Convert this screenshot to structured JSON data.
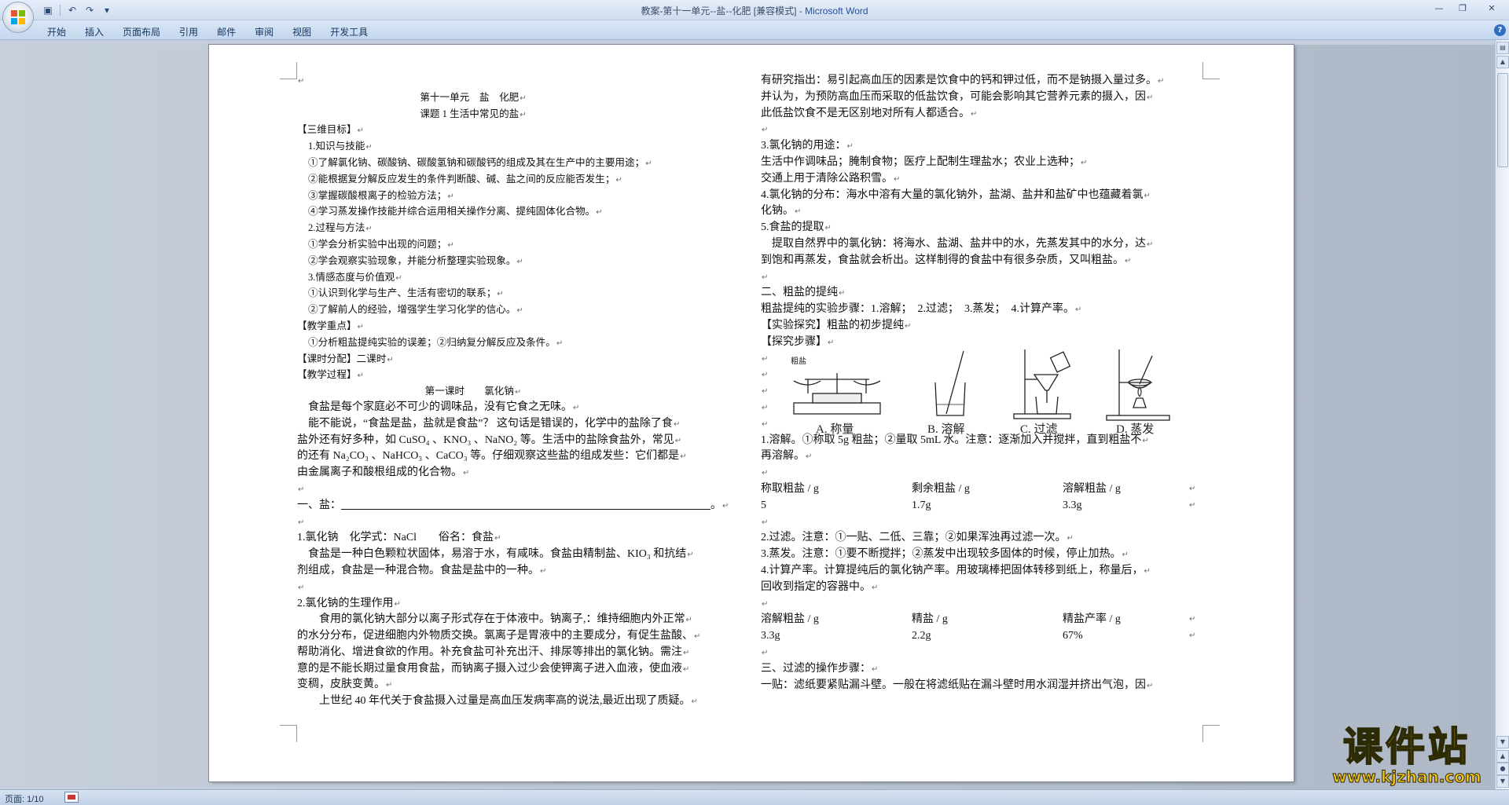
{
  "app": {
    "title_doc": "教案-第十一单元--盐--化肥 [兼容模式] - ",
    "title_app": "Microsoft Word"
  },
  "ribbon": {
    "tabs": [
      "开始",
      "插入",
      "页面布局",
      "引用",
      "邮件",
      "审阅",
      "视图",
      "开发工具"
    ]
  },
  "status": {
    "page": "页面: 1/10"
  },
  "watermark": {
    "title": "课件站",
    "url": "www.kjzhan.com"
  },
  "document": {
    "left": [
      {
        "t": "",
        "c": "ln"
      },
      {
        "t": "第十一单元　盐　化肥",
        "c": "ln center sm"
      },
      {
        "t": "课题 1  生活中常见的盐",
        "c": "ln center sm"
      },
      {
        "t": "【三维目标】",
        "c": "ln sm"
      },
      {
        "t": "1.知识与技能",
        "c": "ln sm i1"
      },
      {
        "t": "①了解氯化钠、碳酸钠、碳酸氢钠和碳酸钙的组成及其在生产中的主要用途；",
        "c": "ln sm i1"
      },
      {
        "t": "②能根据复分解反应发生的条件判断酸、碱、盐之间的反应能否发生；",
        "c": "ln sm i1"
      },
      {
        "t": "③掌握碳酸根离子的检验方法；",
        "c": "ln sm i1"
      },
      {
        "t": "④学习蒸发操作技能并综合运用相关操作分离、提纯固体化合物。",
        "c": "ln sm i1"
      },
      {
        "t": "2.过程与方法",
        "c": "ln sm i1"
      },
      {
        "t": "①学会分析实验中出现的问题；",
        "c": "ln sm i1"
      },
      {
        "t": "②学会观察实验现象，并能分析整理实验现象。",
        "c": "ln sm i1"
      },
      {
        "t": "3.情感态度与价值观",
        "c": "ln sm i1"
      },
      {
        "t": "①认识到化学与生产、生活有密切的联系；",
        "c": "ln sm i1"
      },
      {
        "t": "②了解前人的经验，增强学生学习化学的信心。",
        "c": "ln sm i1"
      },
      {
        "t": "【教学重点】",
        "c": "ln sm"
      },
      {
        "t": "①分析粗盐提纯实验的误差；②归纳复分解反应及条件。",
        "c": "ln sm i1"
      },
      {
        "t": "【课时分配】二课时",
        "c": "ln sm"
      },
      {
        "t": "【教学过程】",
        "c": "ln sm"
      },
      {
        "t": "第一课时　　氯化钠",
        "c": "ln center sm"
      },
      {
        "t": "食盐是每个家庭必不可少的调味品，没有它食之无味。",
        "c": "ln i1"
      },
      {
        "t": "能不能说，“食盐是盐，盐就是食盐”？ 这句话是错误的，化学中的盐除了食",
        "c": "ln i1"
      },
      {
        "t": "盐外还有好多种，如 CuSO₄ 、KNO₃ 、NaNO₂ 等。生活中的盐除食盐外，常见",
        "c": "ln"
      },
      {
        "t": "的还有 Na₂CO₃ 、NaHCO₃ 、CaCO₃ 等。仔细观察这些盐的组成发些：它们都是",
        "c": "ln"
      },
      {
        "t": "由金属离子和酸根组成的化合物。",
        "c": "ln"
      },
      {
        "t": "",
        "c": "ln"
      },
      {
        "t": "一、盐：",
        "c": "ln",
        "blank": true,
        "after": "。"
      },
      {
        "t": "",
        "c": "ln"
      },
      {
        "t": "1.氯化钠　化学式：NaCl　　俗名：食盐",
        "c": "ln"
      },
      {
        "t": "食盐是一种白色颗粒状固体，易溶于水，有咸味。食盐由精制盐、KIO₃ 和抗结",
        "c": "ln i1"
      },
      {
        "t": "剂组成，食盐是一种混合物。食盐是盐中的一种。",
        "c": "ln"
      },
      {
        "t": "",
        "c": "ln"
      },
      {
        "t": "2.氯化钠的生理作用",
        "c": "ln"
      },
      {
        "t": "食用的氯化钠大部分以离子形式存在于体液中。钠离子,：维持细胞内外正常",
        "c": "ln i2"
      },
      {
        "t": "的水分分布，促进细胞内外物质交换。氯离子是胃液中的主要成分，有促生盐酸、",
        "c": "ln"
      },
      {
        "t": "帮助消化、增进食欲的作用。补充食盐可补充出汗、排尿等排出的氯化钠。需注",
        "c": "ln"
      },
      {
        "t": "意的是不能长期过量食用食盐，而钠离子摄入过少会使钾离子进入血液，使血液",
        "c": "ln"
      },
      {
        "t": "变稠，皮肤变黄。",
        "c": "ln"
      },
      {
        "t": "上世纪 40 年代关于食盐摄入过量是高血压发病率高的说法,最近出现了质疑。",
        "c": "ln i2"
      }
    ],
    "right": [
      {
        "t": "有研究指出：易引起高血压的因素是饮食中的钙和钾过低，而不是钠摄入量过多。",
        "c": "ln"
      },
      {
        "t": "并认为，为预防高血压而采取的低盐饮食，可能会影响其它营养元素的摄入，因",
        "c": "ln"
      },
      {
        "t": "此低盐饮食不是无区别地对所有人都适合。",
        "c": "ln"
      },
      {
        "t": "",
        "c": "ln"
      },
      {
        "t": "3.氯化钠的用途：",
        "c": "ln"
      },
      {
        "t": "生活中作调味品；腌制食物；医疗上配制生理盐水；农业上选种；",
        "c": "ln"
      },
      {
        "t": "交通上用于清除公路积雪。",
        "c": "ln"
      },
      {
        "t": "4.氯化钠的分布：海水中溶有大量的氯化钠外，盐湖、盐井和盐矿中也蕴藏着氯",
        "c": "ln"
      },
      {
        "t": "化钠。",
        "c": "ln"
      },
      {
        "t": "5.食盐的提取",
        "c": "ln"
      },
      {
        "t": "提取自然界中的氯化钠：将海水、盐湖、盐井中的水，先蒸发其中的水分，达",
        "c": "ln i1"
      },
      {
        "t": "到饱和再蒸发，食盐就会析出。这样制得的食盐中有很多杂质，又叫粗盐。",
        "c": "ln"
      },
      {
        "t": "",
        "c": "ln"
      },
      {
        "t": "二、粗盐的提纯",
        "c": "ln"
      },
      {
        "t": "粗盐提纯的实验步骤：1.溶解；　2.过滤；　3.蒸发；　4.计算产率。",
        "c": "ln"
      },
      {
        "t": "【实验探究】粗盐的初步提纯",
        "c": "ln"
      },
      {
        "t": "【探究步骤】",
        "c": "ln"
      }
    ],
    "right_after_figure": [
      {
        "t": "1.溶解。①称取 5g 粗盐；②量取 5mL 水。注意：逐渐加入并搅拌，直到粗盐不",
        "c": "ln"
      },
      {
        "t": "再溶解。",
        "c": "ln"
      },
      {
        "t": "",
        "c": "ln"
      }
    ],
    "table1": {
      "headers": [
        "称取粗盐 / g",
        "剩余粗盐 / g",
        "溶解粗盐 / g"
      ],
      "values": [
        "5",
        "1.7g",
        "3.3g"
      ]
    },
    "right_mid": [
      {
        "t": "",
        "c": "ln"
      },
      {
        "t": "2.过滤。注意：①一贴、二低、三靠；②如果浑浊再过滤一次。",
        "c": "ln"
      },
      {
        "t": "3.蒸发。注意：①要不断搅拌；②蒸发中出现较多固体的时候，停止加热。",
        "c": "ln"
      },
      {
        "t": "4.计算产率。计算提纯后的氯化钠产率。用玻璃棒把固体转移到纸上，称量后，",
        "c": "ln"
      },
      {
        "t": "回收到指定的容器中。",
        "c": "ln"
      },
      {
        "t": "",
        "c": "ln"
      }
    ],
    "table2": {
      "headers": [
        "溶解粗盐 / g",
        "精盐 / g",
        "精盐产率 / g"
      ],
      "values": [
        "3.3g",
        "2.2g",
        "67%"
      ]
    },
    "right_end": [
      {
        "t": "",
        "c": "ln"
      },
      {
        "t": "三、过滤的操作步骤：",
        "c": "ln"
      },
      {
        "t": "一贴：滤纸要紧贴漏斗壁。一般在将滤纸贴在漏斗壁时用水润湿并挤出气泡，因",
        "c": "ln"
      }
    ],
    "figure": {
      "top_label": "粗盐",
      "captions": [
        "A. 称量",
        "B. 溶解",
        "C. 过滤",
        "D. 蒸发"
      ]
    }
  }
}
